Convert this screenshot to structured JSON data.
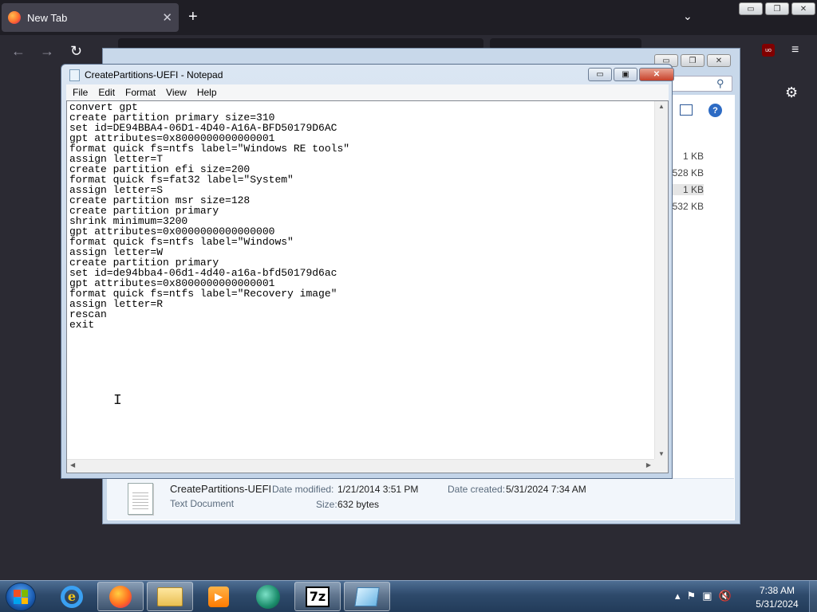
{
  "firefox": {
    "tab_title": "New Tab",
    "tab_close": "✕",
    "new_tab": "+",
    "tab_list": "⌄",
    "back": "←",
    "forward": "→",
    "reload": "↻",
    "ublock_badge": "uo",
    "menu": "≡",
    "gear": "⚙",
    "window_controls": {
      "minimize": "▭",
      "restore": "❐",
      "close": "✕"
    }
  },
  "explorer": {
    "search_icon": "⚲",
    "help": "?",
    "file_sizes": [
      "1 KB",
      "528 KB",
      "1 KB",
      "532 KB"
    ],
    "details": {
      "file_name": "CreatePartitions-UEFI",
      "file_type": "Text Document",
      "date_modified_label": "Date modified:",
      "date_modified_value": "1/21/2014 3:51 PM",
      "date_created_label": "Date created:",
      "date_created_value": "5/31/2024 7:34 AM",
      "size_label": "Size:",
      "size_value": "632 bytes"
    },
    "window_controls": {
      "minimize": "▭",
      "restore": "❐",
      "close": "✕"
    }
  },
  "notepad": {
    "title": "CreatePartitions-UEFI - Notepad",
    "menu": [
      "File",
      "Edit",
      "Format",
      "View",
      "Help"
    ],
    "window_controls": {
      "minimize": "▭",
      "restore": "▣",
      "close": "✕"
    },
    "content": "convert gpt\ncreate partition primary size=310\nset id=DE94BBA4-06D1-4D40-A16A-BFD50179D6AC\ngpt attributes=0x8000000000000001\nformat quick fs=ntfs label=\"Windows RE tools\"\nassign letter=T\ncreate partition efi size=200\nformat quick fs=fat32 label=\"System\"\nassign letter=S\ncreate partition msr size=128\ncreate partition primary\nshrink minimum=3200\ngpt attributes=0x0000000000000000\nformat quick fs=ntfs label=\"Windows\"\nassign letter=W\ncreate partition primary\nset id=de94bba4-06d1-4d40-a16a-bfd50179d6ac\ngpt attributes=0x8000000000000001\nformat quick fs=ntfs label=\"Recovery image\"\nassign letter=R\nrescan\nexit",
    "scroll_up": "▲",
    "scroll_down": "▼",
    "scroll_left": "◀",
    "scroll_right": "▶",
    "cursor": "I"
  },
  "taskbar": {
    "ie_glyph": "e",
    "media_glyph": "▶",
    "sevenzip_label": "7z",
    "tray_icons": [
      "▴",
      "⚑",
      "▣",
      "🔇"
    ],
    "clock_time": "7:38 AM",
    "clock_date": "5/31/2024"
  }
}
